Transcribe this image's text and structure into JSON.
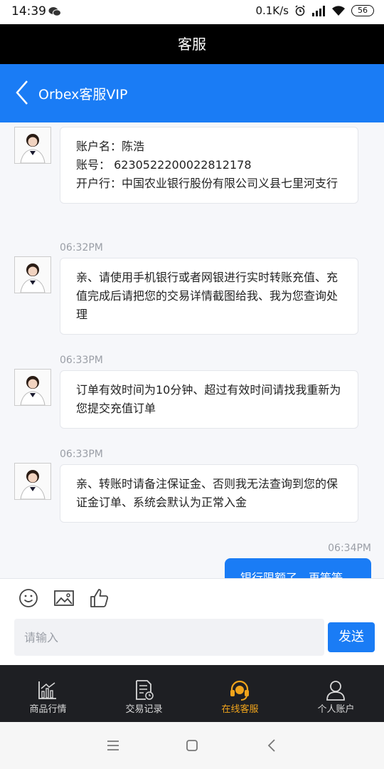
{
  "status": {
    "time": "14:39",
    "speed": "0.1K/s",
    "battery": "56"
  },
  "title": "客服",
  "chat_header": {
    "title": "Orbex客服VIP"
  },
  "messages": [
    {
      "lines": [
        "账户名：陈浩",
        "账号：  6230522200022812178",
        "开户行：中国农业银行股份有限公司义县七里河支行"
      ]
    },
    {
      "time": "06:32PM",
      "text": "亲、请使用手机银行或者网银进行实时转账充值、充值完成后请把您的交易详情截图给我、我为您查询处理"
    },
    {
      "time": "06:33PM",
      "text": "订单有效时间为10分钟、超过有效时间请找我重新为您提交充值订单"
    },
    {
      "time": "06:33PM",
      "text": "亲、转账时请备注保证金、否则我无法查询到您的保证金订单、系统会默认为正常入金"
    }
  ],
  "outgoing": {
    "time": "06:34PM",
    "text": "银行限额了，再等等"
  },
  "input": {
    "placeholder": "请输入",
    "send_label": "发送"
  },
  "tabs": [
    {
      "label": "商品行情",
      "icon": "chart-icon"
    },
    {
      "label": "交易记录",
      "icon": "document-clock-icon"
    },
    {
      "label": "在线客服",
      "icon": "headset-icon",
      "active": true
    },
    {
      "label": "个人账户",
      "icon": "person-icon"
    }
  ],
  "colors": {
    "accent": "#1a7cf5",
    "tab_active": "#f0a41c",
    "tabbar_bg": "#1e1f23"
  }
}
